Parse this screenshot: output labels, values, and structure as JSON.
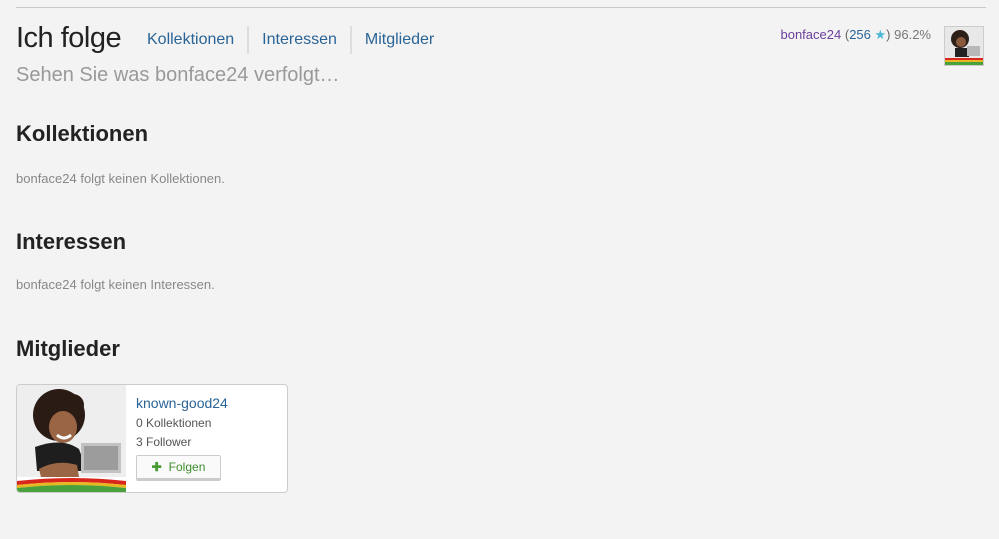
{
  "header": {
    "title": "Ich folge",
    "subtitle": "Sehen Sie was bonface24 verfolgt…",
    "tabs": [
      "Kollektionen",
      "Interessen",
      "Mitglieder"
    ]
  },
  "user": {
    "name": "bonface24",
    "reputation": "256",
    "star_icon": "star-icon",
    "percentage": "96.2%"
  },
  "sections": {
    "collections": {
      "title": "Kollektionen",
      "empty_text": "bonface24 folgt keinen Kollektionen."
    },
    "interests": {
      "title": "Interessen",
      "empty_text": "bonface24 folgt keinen Interessen."
    },
    "members": {
      "title": "Mitglieder"
    }
  },
  "member_card": {
    "name": "known-good24",
    "collections": "0 Kollektionen",
    "followers": "3 Follower",
    "follow_label": "Folgen"
  },
  "colors": {
    "link": "#2a6496",
    "username": "#6a3f9a",
    "follow_green": "#3e8d2c",
    "star": "#4ab8d8"
  }
}
